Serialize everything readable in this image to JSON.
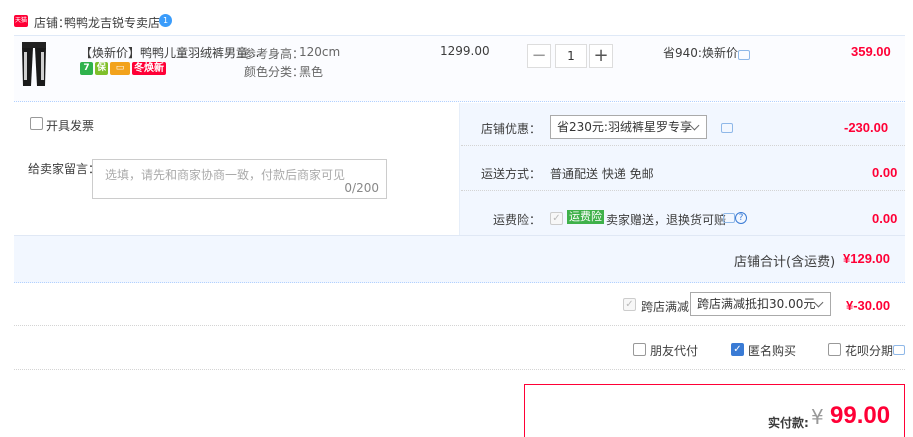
{
  "shop": {
    "badge": "天猫",
    "label": "店铺：",
    "name": "鸭鸭龙吉锐专卖店",
    "icon": "shop-verified-icon"
  },
  "item": {
    "title": "【焕新价】鸭鸭儿童羽绒裤男童...",
    "height_label": "参考身高：",
    "height_value": "120cm",
    "color_label": "颜色分类：",
    "color_value": "黑色",
    "tags": [
      "7",
      "",
      "",
      "冬焕新"
    ],
    "unit_price": "1299.00",
    "quantity": "1",
    "save_note": "省940:焕新价",
    "subtotal": "359.00"
  },
  "invoice": {
    "label": "开具发票"
  },
  "message": {
    "label": "给卖家留言：",
    "placeholder": "选填，请先和商家协商一致，付款后商家可见",
    "counter": "0/200"
  },
  "shop_discount": {
    "label": "店铺优惠：",
    "selected": "省230元:羽绒裤星罗专享",
    "amount": "-230.00"
  },
  "shipping": {
    "label": "运送方式：",
    "value": "普通配送 快递 免邮",
    "amount": "0.00"
  },
  "insurance": {
    "label": "运费险：",
    "tag": "运费险",
    "desc": "卖家赠送，退换货可赔",
    "amount": "0.00"
  },
  "shop_total": {
    "label": "店铺合计(含运费)",
    "amount": "¥129.00"
  },
  "cross_store": {
    "label": "跨店满减",
    "selected": "跨店满减抵扣30.00元",
    "amount": "¥-30.00"
  },
  "options": {
    "friend_pay": "朋友代付",
    "anonymous": "匿名购买",
    "huabei": "花呗分期"
  },
  "final": {
    "label": "实付款:",
    "currency": "¥",
    "amount": "99.00"
  },
  "colors": {
    "accent": "#ff0036",
    "panel": "#f2f7ff",
    "link": "#3a7bd5"
  }
}
